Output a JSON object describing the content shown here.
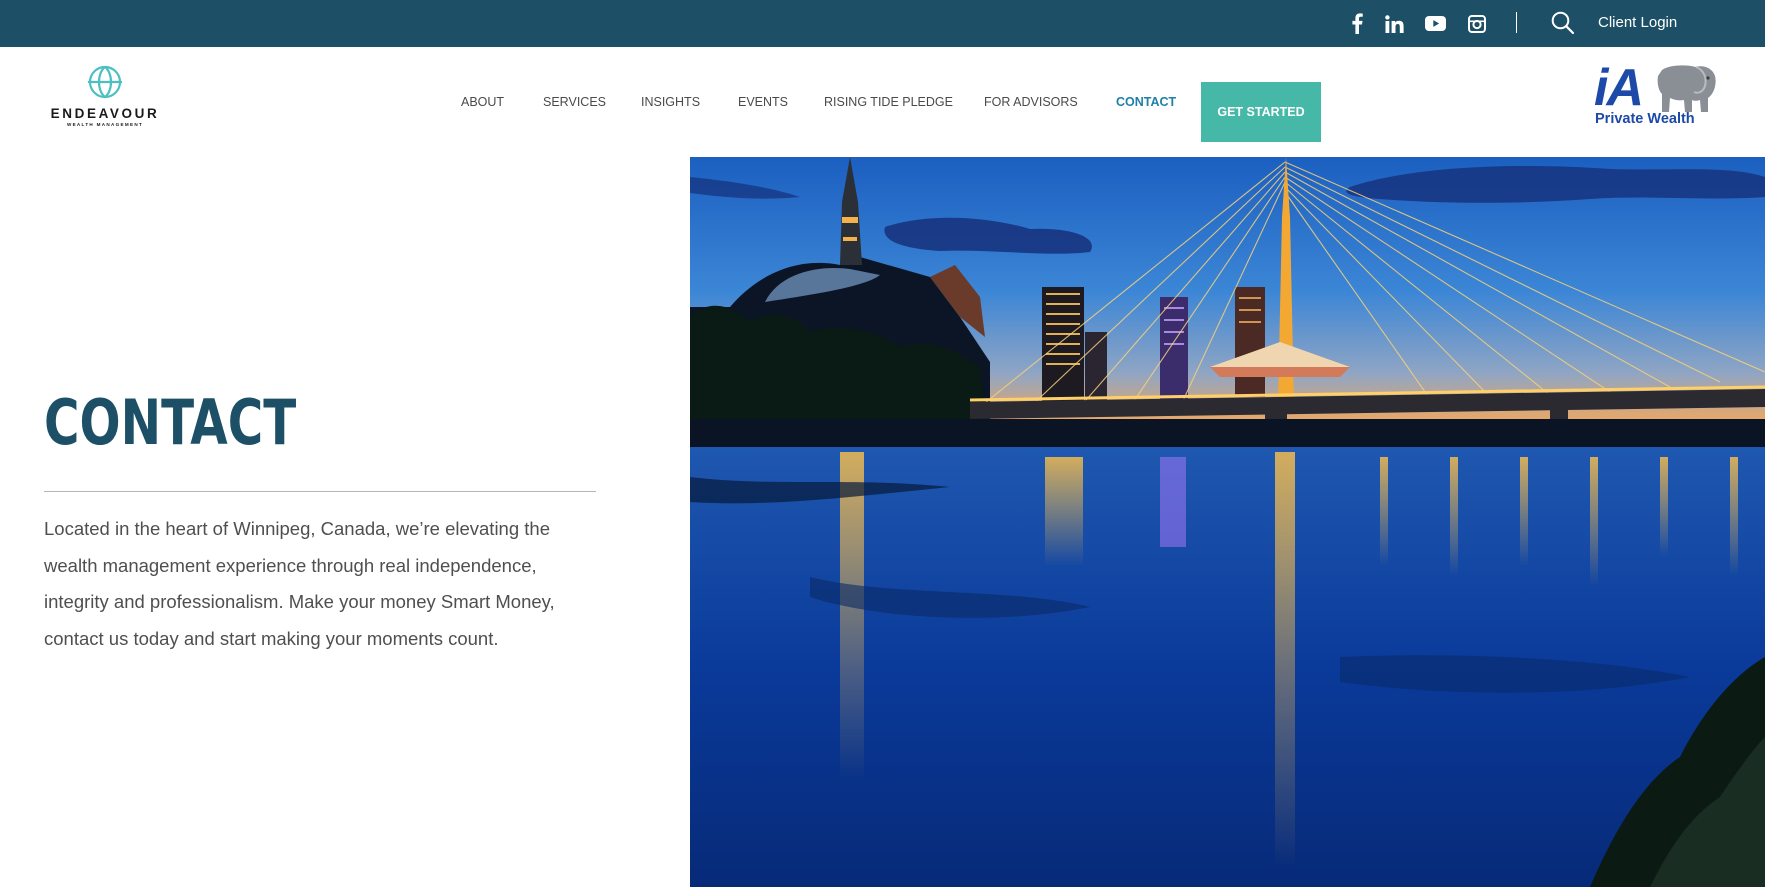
{
  "topbar": {
    "social_icons": [
      "facebook-icon",
      "linkedin-icon",
      "youtube-icon",
      "instagram-icon"
    ],
    "search_icon": "search-icon",
    "client_login": "Client Login"
  },
  "header": {
    "logo": {
      "name": "ENDEAVOUR",
      "tagline": "WEALTH MANAGEMENT"
    },
    "nav": [
      "ABOUT",
      "SERVICES",
      "INSIGHTS",
      "EVENTS",
      "RISING TIDE PLEDGE",
      "FOR ADVISORS",
      "CONTACT"
    ],
    "active_nav": "CONTACT",
    "cta": "GET STARTED",
    "partner_logo": {
      "mark": "iA",
      "name": "Private Wealth"
    }
  },
  "hero": {
    "title": "CONTACT",
    "text": "Located in the heart of Winnipeg, Canada, we’re elevating the wealth management experience through real independence, integrity and professionalism. Make your money Smart Money, contact us today and start making your moments count."
  },
  "colors": {
    "topbar": "#1d4f66",
    "title": "#1d4f66",
    "nav_active": "#1f7fa8",
    "cta": "#45b8a7",
    "partner_blue": "#1d4aa8"
  }
}
